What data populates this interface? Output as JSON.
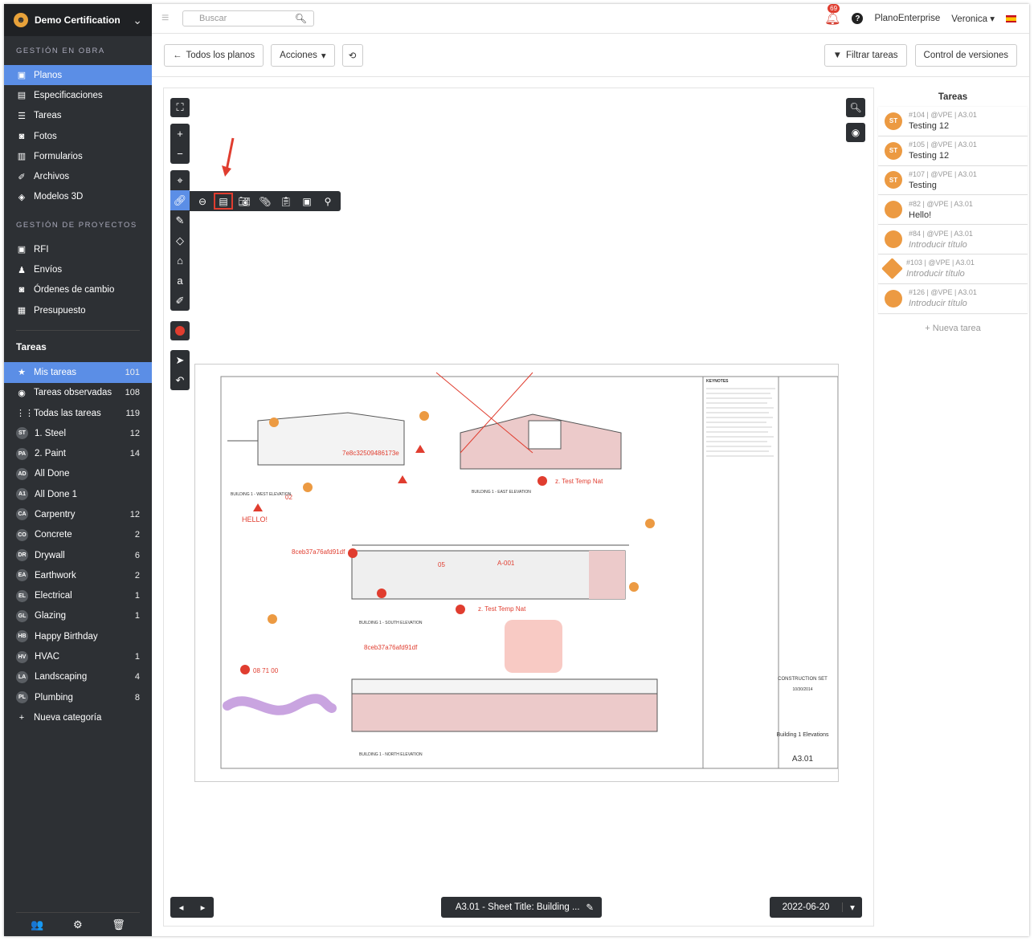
{
  "project": {
    "name": "Demo Certification"
  },
  "sidebar": {
    "section1": "GESTIÓN EN OBRA",
    "obra": [
      {
        "label": "Planos",
        "icon": "plans-icon"
      },
      {
        "label": "Especificaciones",
        "icon": "specs-icon"
      },
      {
        "label": "Tareas",
        "icon": "tasks-icon"
      },
      {
        "label": "Fotos",
        "icon": "camera-icon"
      },
      {
        "label": "Formularios",
        "icon": "forms-icon"
      },
      {
        "label": "Archivos",
        "icon": "paperclip-icon"
      },
      {
        "label": "Modelos 3D",
        "icon": "cube-icon"
      }
    ],
    "section2": "GESTIÓN DE PROYECTOS",
    "proyectos": [
      {
        "label": "RFI"
      },
      {
        "label": "Envíos"
      },
      {
        "label": "Órdenes de cambio"
      },
      {
        "label": "Presupuesto"
      }
    ],
    "tareas_title": "Tareas",
    "tareas": [
      {
        "label": "Mis tareas",
        "count": "101"
      },
      {
        "label": "Tareas observadas",
        "count": "108"
      },
      {
        "label": "Todas las tareas",
        "count": "119"
      }
    ],
    "categories": [
      {
        "abbr": "ST",
        "label": "1. Steel",
        "count": "12"
      },
      {
        "abbr": "PA",
        "label": "2. Paint",
        "count": "14"
      },
      {
        "abbr": "AD",
        "label": "All Done",
        "count": ""
      },
      {
        "abbr": "A1",
        "label": "All Done 1",
        "count": ""
      },
      {
        "abbr": "CA",
        "label": "Carpentry",
        "count": "12"
      },
      {
        "abbr": "CO",
        "label": "Concrete",
        "count": "2"
      },
      {
        "abbr": "DR",
        "label": "Drywall",
        "count": "6"
      },
      {
        "abbr": "EA",
        "label": "Earthwork",
        "count": "2"
      },
      {
        "abbr": "EL",
        "label": "Electrical",
        "count": "1"
      },
      {
        "abbr": "GL",
        "label": "Glazing",
        "count": "1"
      },
      {
        "abbr": "HB",
        "label": "Happy Birthday",
        "count": ""
      },
      {
        "abbr": "HV",
        "label": "HVAC",
        "count": "1"
      },
      {
        "abbr": "LA",
        "label": "Landscaping",
        "count": "4"
      },
      {
        "abbr": "PL",
        "label": "Plumbing",
        "count": "8"
      }
    ],
    "new_category": "Nueva categoría"
  },
  "topbar": {
    "search_placeholder": "Buscar",
    "notifications": "69",
    "account": "PlanoEnterprise",
    "user": "Veronica"
  },
  "toolbar": {
    "back": "Todos los planos",
    "actions": "Acciones",
    "filter": "Filtrar tareas",
    "versions": "Control de versiones"
  },
  "viewer": {
    "sheet_title": "A3.01 - Sheet Title: Building ...",
    "date": "2022-06-20"
  },
  "tasks_panel": {
    "title": "Tareas",
    "new_task": "+ Nueva tarea",
    "tasks": [
      {
        "meta": "#104 | @VPE | A3.01",
        "title": "Testing 12",
        "avatar": "ST",
        "italic": false
      },
      {
        "meta": "#105 | @VPE | A3.01",
        "title": "Testing 12",
        "avatar": "ST",
        "italic": false
      },
      {
        "meta": "#107 | @VPE | A3.01",
        "title": "Testing",
        "avatar": "ST",
        "italic": false
      },
      {
        "meta": "#82 | @VPE | A3.01",
        "title": "Hello!",
        "avatar": "",
        "italic": false
      },
      {
        "meta": "#84 | @VPE | A3.01",
        "title": "Introducir título",
        "avatar": "",
        "italic": true
      },
      {
        "meta": "#103 | @VPE | A3.01",
        "title": "Introducir título",
        "avatar": "",
        "italic": true
      },
      {
        "meta": "#126 | @VPE | A3.01",
        "title": "Introducir título",
        "avatar": "",
        "italic": true
      }
    ]
  },
  "drawing": {
    "annotations": [
      "7e8c32509486173e",
      "z. Test Temp Nat",
      "HELLO!",
      "8ceb37a76afd91df",
      "A-001",
      "z. Test Temp Nat",
      "8ceb37a76afd91df",
      "08 71 00",
      "02",
      "05"
    ],
    "elevations": [
      "BUILDING 1 - WEST ELEVATION",
      "BUILDING 1 - EAST ELEVATION",
      "BUILDING 1 - SOUTH ELEVATION",
      "BUILDING 1 - NORTH ELEVATION"
    ],
    "keynotes_title": "KEYNOTES",
    "title_block": {
      "set": "CONSTRUCTION SET",
      "date": "10/30/2014",
      "title": "Building 1 Elevations",
      "sheet": "A3.01"
    }
  },
  "colors": {
    "accent": "#5b8ee6",
    "marker": "#ec9a42",
    "annotation": "#e03d2f",
    "sidebar": "#2d3034"
  }
}
